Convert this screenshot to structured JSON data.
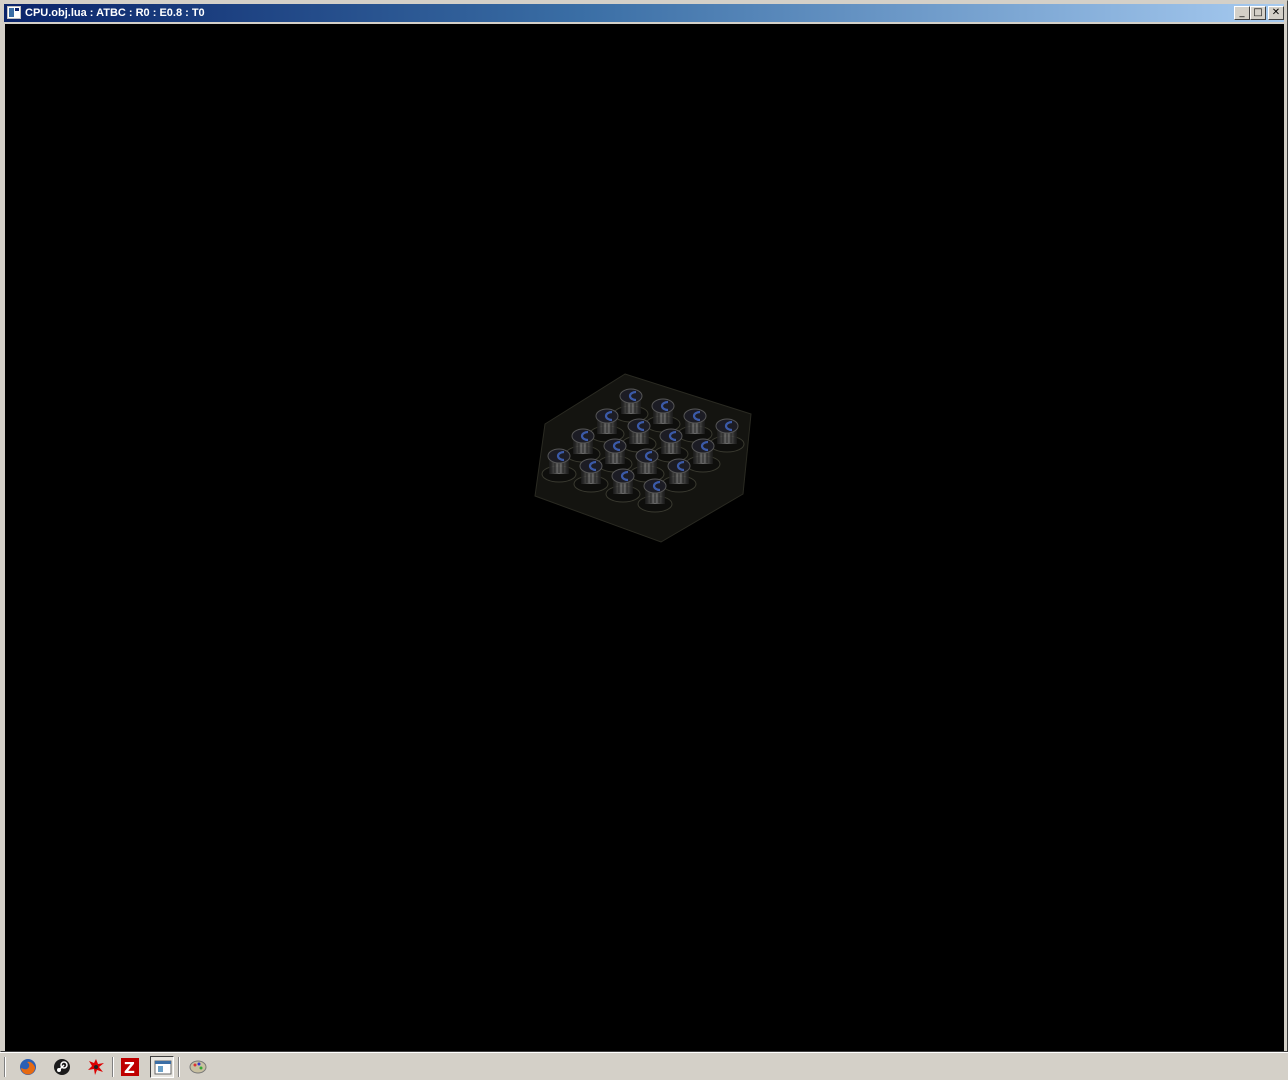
{
  "window": {
    "title": "CPU.obj.lua : ATBC : R0 : E0.8 : T0",
    "controls": {
      "minimize": "_",
      "maximize": "□",
      "close": "✕"
    }
  },
  "viewport": {
    "background": "#000000",
    "scene": "cpu-grid-model"
  },
  "taskbar": {
    "quick_launch": [
      {
        "name": "firefox-icon"
      },
      {
        "name": "steam-icon"
      },
      {
        "name": "red-splat-app-icon"
      },
      {
        "name": "filezilla-icon"
      },
      {
        "name": "window-app-icon",
        "active": true
      },
      {
        "name": "palette-app-icon"
      }
    ]
  },
  "colors": {
    "titlebar_start": "#0a246a",
    "titlebar_end": "#a6caf0",
    "chrome": "#d4d0c8",
    "model_accent": "#3b5aa8"
  }
}
